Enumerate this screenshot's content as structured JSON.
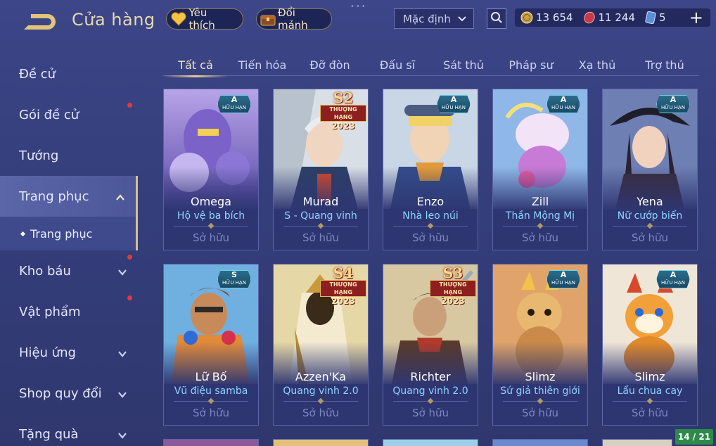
{
  "header": {
    "title": "Cửa hàng",
    "favorites_label": "Yêu thích",
    "exchange_label": "Đổi mảnh",
    "sort_value": "Mặc định"
  },
  "currency": {
    "gold": "13 654",
    "vouchers": "11 244",
    "tickets": "5"
  },
  "sidebar": {
    "items": [
      {
        "label": "Đề cử"
      },
      {
        "label": "Gói đề cử"
      },
      {
        "label": "Tướng"
      },
      {
        "label": "Trang phục"
      },
      {
        "label": "Kho báu"
      },
      {
        "label": "Vật phẩm"
      },
      {
        "label": "Hiệu ứng"
      },
      {
        "label": "Shop quy đổi"
      },
      {
        "label": "Tặng quà"
      }
    ],
    "sub_item": "Trang phục"
  },
  "tabs": [
    "Tất cả",
    "Tiến hóa",
    "Đỡ đòn",
    "Đấu sĩ",
    "Sát thủ",
    "Pháp sư",
    "Xạ thủ",
    "Trợ thủ"
  ],
  "cards": [
    {
      "hero": "Omega",
      "skin": "Hộ vệ ba bích",
      "status": "Sở hữu",
      "badge_grade": "A",
      "badge_text": "HỮU HẠN"
    },
    {
      "hero": "Murad",
      "skin": "S - Quang vinh",
      "status": "Sở hữu",
      "season": "S2",
      "season_label": "THƯỢNG HẠNG",
      "season_year": "2023"
    },
    {
      "hero": "Enzo",
      "skin": "Nhà leo núi",
      "status": "Sở hữu",
      "badge_grade": "A",
      "badge_text": "HỮU HẠN"
    },
    {
      "hero": "Zill",
      "skin": "Thần Mộng Mị",
      "status": "Sở hữu",
      "badge_grade": "A",
      "badge_text": "HỮU HẠN"
    },
    {
      "hero": "Yena",
      "skin": "Nữ cướp biển",
      "status": "Sở hữu",
      "badge_grade": "A",
      "badge_text": "HỮU HẠN"
    },
    {
      "hero": "Lữ Bố",
      "skin": "Vũ điệu samba",
      "status": "Sở hữu",
      "badge_grade": "S",
      "badge_text": "HỮU HẠN"
    },
    {
      "hero": "Azzen'Ka",
      "skin": "Quang vinh 2.0",
      "status": "Sở hữu",
      "season": "S4",
      "season_label": "THƯỢNG HẠNG",
      "season_year": "2023"
    },
    {
      "hero": "Richter",
      "skin": "Quang vinh 2.0",
      "status": "Sở hữu",
      "season": "S3",
      "season_label": "THƯỢNG HẠNG",
      "season_year": "2023"
    },
    {
      "hero": "Slimz",
      "skin": "Sứ giả thiên giới",
      "status": "Sở hữu",
      "badge_grade": "A",
      "badge_text": "HỮU HẠN"
    },
    {
      "hero": "Slimz",
      "skin": "Lẩu chua cay",
      "status": "Sở hữu",
      "badge_grade": "A",
      "badge_text": "HỮU HẠN"
    }
  ],
  "pagination": "14 / 21",
  "colors": {
    "accent_gold": "#e6d9b0",
    "skin_name": "#8fd3ff",
    "notification_dot": "#e23a3a",
    "page_counter_bg": "#2e8a4a"
  }
}
